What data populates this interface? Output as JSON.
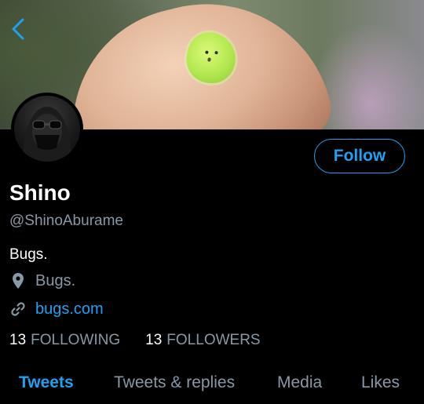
{
  "profile": {
    "name": "Shino",
    "handle": "@ShinoAburame",
    "bio": "Bugs.",
    "location": "Bugs.",
    "website": "bugs.com",
    "following_count": "13",
    "following_label": "FOLLOWING",
    "followers_count": "13",
    "followers_label": "FOLLOWERS"
  },
  "actions": {
    "follow_label": "Follow"
  },
  "tabs": [
    {
      "label": "Tweets",
      "active": true
    },
    {
      "label": "Tweets & replies",
      "active": false
    },
    {
      "label": "Media",
      "active": false
    },
    {
      "label": "Likes",
      "active": false
    }
  ],
  "icons": {
    "back": "chevron-left-icon",
    "location": "location-pin-icon",
    "link": "link-icon"
  },
  "colors": {
    "accent": "#1da1f2",
    "secondary_text": "#8899a6",
    "background": "#000000"
  }
}
